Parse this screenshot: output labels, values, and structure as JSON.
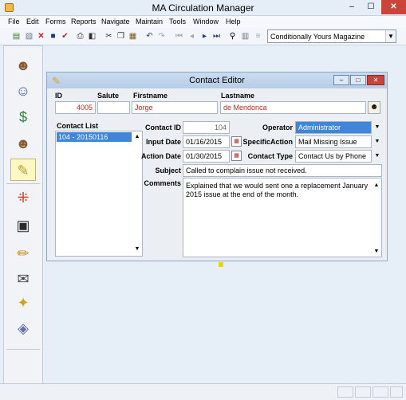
{
  "app": {
    "title": "MA Circulation Manager",
    "window_controls": {
      "minimize": "–",
      "maximize": "☐",
      "close": "✕"
    }
  },
  "menu": [
    "File",
    "Edit",
    "Forms",
    "Reports",
    "Navigate",
    "Maintain",
    "Tools",
    "Window",
    "Help"
  ],
  "toolbar": {
    "publication_combo": "Conditionally Yours Magazine",
    "icons": [
      "new-icon",
      "open-icon",
      "delete-icon",
      "save-icon",
      "spellcheck-icon",
      "print-icon",
      "print-preview-icon",
      "cut-icon",
      "copy-icon",
      "paste-icon",
      "undo-icon",
      "redo-icon",
      "first-record-icon",
      "previous-record-icon",
      "next-record-icon",
      "last-record-icon",
      "find-icon",
      "filter-icon",
      "sort-icon"
    ]
  },
  "left_panel": {
    "icons": [
      "contact-icon",
      "group-icon",
      "money-bag-icon",
      "contacts-icon",
      "contact-editor-icon",
      "network-icon",
      "calendar-icon",
      "edit-icon",
      "mail-label-icon",
      "coupon-icon",
      "tickets-icon"
    ]
  },
  "dialog": {
    "title": "Contact Editor",
    "labels": {
      "id": "ID",
      "salute": "Salute",
      "firstname": "Firstname",
      "lastname": "Lastname",
      "contact_list": "Contact List",
      "contact_id": "Contact ID",
      "input_date": "Input Date",
      "action_date": "Action Date",
      "subject": "Subject",
      "comments": "Comments",
      "operator": "Operator",
      "specific_action": "SpecificAction",
      "contact_type": "Contact Type"
    },
    "values": {
      "id": "4005",
      "salute": "",
      "firstname": "Jorge",
      "lastname": "de Mendonca",
      "contact_id": "104",
      "input_date": "01/16/2015",
      "action_date": "01/30/2015",
      "subject": "Called to complain issue not received.",
      "comments": "Explained that we would sent one a replacement January 2015 issue at the end of the month.",
      "operator": "Administrator",
      "specific_action": "Mail Missing Issue",
      "contact_type": "Contact Us by Phone"
    },
    "contact_list_items": [
      "104 - 20150116"
    ]
  }
}
